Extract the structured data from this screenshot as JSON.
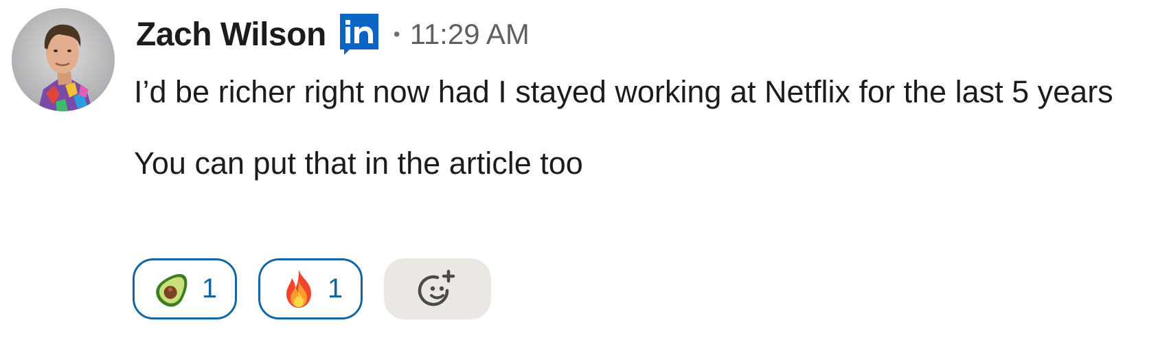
{
  "message": {
    "author": {
      "name": "Zach Wilson",
      "badge_icon": "linkedin-icon",
      "avatar_icon": "avatar-photo"
    },
    "separator": "•",
    "timestamp": "11:29 AM",
    "paragraphs": [
      "I’d be richer right now had I stayed working at Netflix for the last 5 years",
      "You can put that in the article too"
    ],
    "reactions": [
      {
        "emoji_icon": "avocado-icon",
        "count": "1",
        "selected": true
      },
      {
        "emoji_icon": "fire-icon",
        "count": "1",
        "selected": true
      }
    ],
    "add_reaction_icon": "add-reaction-icon"
  },
  "colors": {
    "text": "#1d1c1d",
    "muted": "#616061",
    "reaction_border": "#1264a3",
    "reaction_count": "#1264a3",
    "add_reaction_bg": "#ebe8e4",
    "linkedin_blue": "#0a66c2"
  }
}
